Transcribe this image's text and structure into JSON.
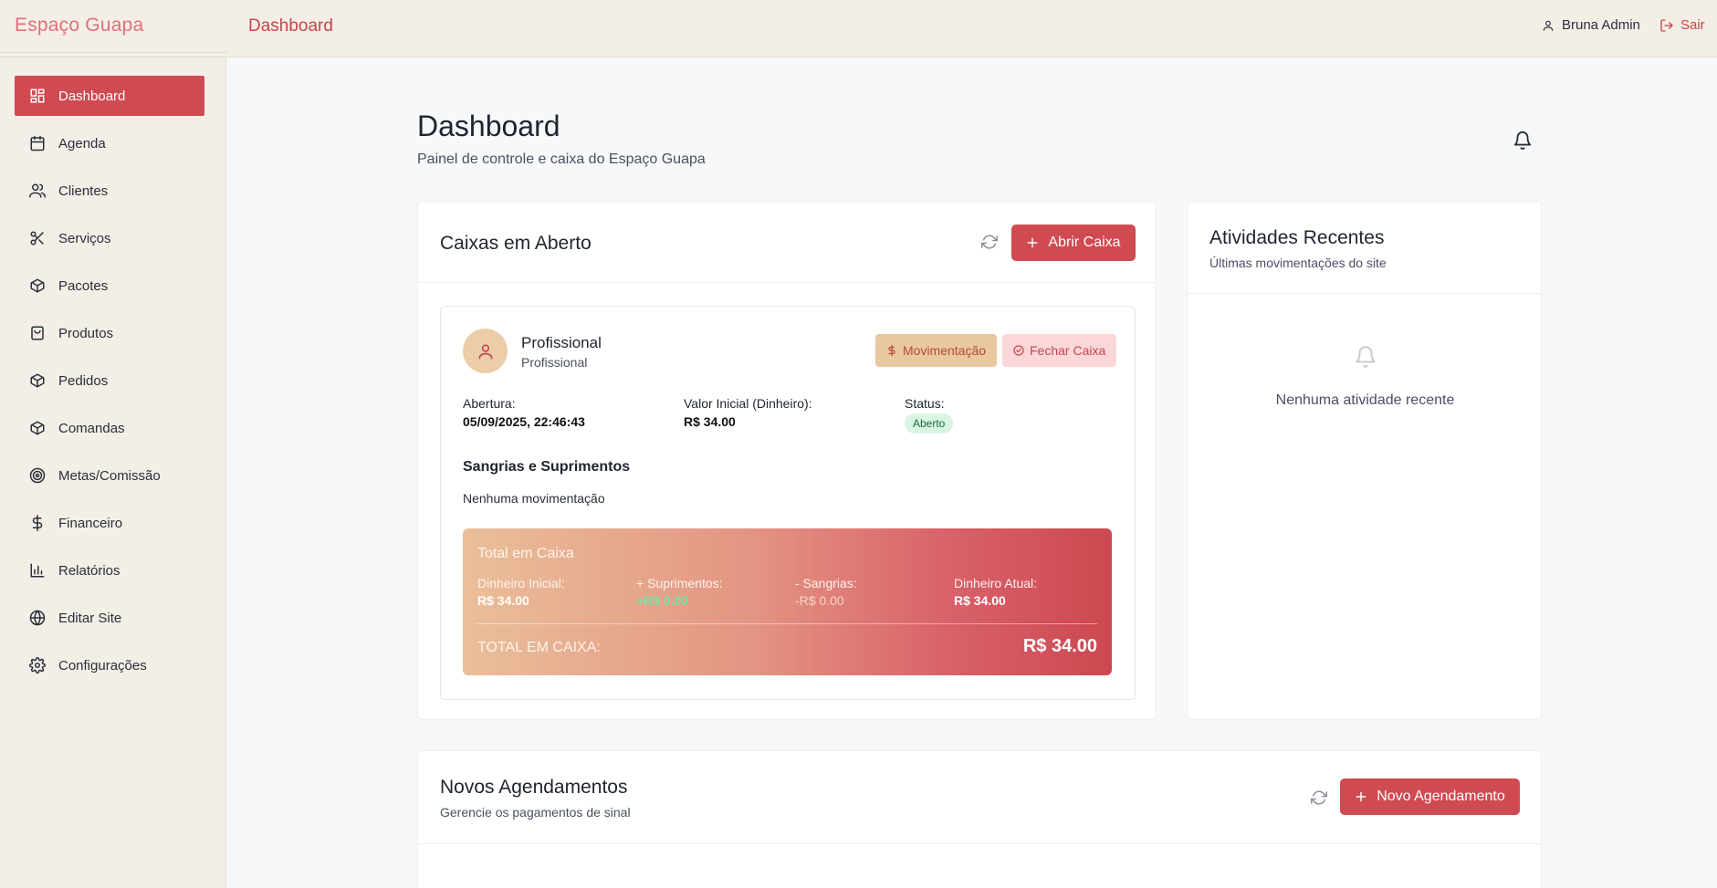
{
  "app": {
    "brand": "Espaço Guapa",
    "header_title": "Dashboard"
  },
  "user": {
    "name": "Bruna Admin",
    "logout_label": "Sair"
  },
  "sidebar": {
    "items": [
      {
        "label": "Dashboard",
        "icon": "dashboard-icon",
        "active": true
      },
      {
        "label": "Agenda",
        "icon": "calendar-icon"
      },
      {
        "label": "Clientes",
        "icon": "users-icon"
      },
      {
        "label": "Serviços",
        "icon": "scissors-icon"
      },
      {
        "label": "Pacotes",
        "icon": "package-icon"
      },
      {
        "label": "Produtos",
        "icon": "shopping-bag-icon"
      },
      {
        "label": "Pedidos",
        "icon": "package-icon"
      },
      {
        "label": "Comandas",
        "icon": "package-icon"
      },
      {
        "label": "Metas/Comissão",
        "icon": "target-icon"
      },
      {
        "label": "Financeiro",
        "icon": "dollar-icon"
      },
      {
        "label": "Relatórios",
        "icon": "bar-chart-icon"
      },
      {
        "label": "Editar Site",
        "icon": "globe-icon"
      },
      {
        "label": "Configurações",
        "icon": "gear-icon"
      }
    ]
  },
  "page": {
    "title": "Dashboard",
    "subtitle": "Painel de controle e caixa do Espaço Guapa"
  },
  "caixas": {
    "title": "Caixas em Aberto",
    "open_button": "Abrir Caixa",
    "session": {
      "name": "Profissional",
      "role": "Profissional",
      "movement_button": "Movimentação",
      "close_button": "Fechar Caixa",
      "opening_label": "Abertura:",
      "opening_value": "05/09/2025, 22:46:43",
      "initial_label": "Valor Inicial (Dinheiro):",
      "initial_value": "R$ 34.00",
      "status_label": "Status:",
      "status_value": "Aberto",
      "movements_title": "Sangrias e Suprimentos",
      "movements_empty": "Nenhuma movimentação",
      "total": {
        "heading": "Total em Caixa",
        "cash_initial_label": "Dinheiro Inicial:",
        "cash_initial_value": "R$ 34.00",
        "supplies_label": "+ Suprimentos:",
        "supplies_value": "+R$ 0.00",
        "withdrawals_label": "- Sangrias:",
        "withdrawals_value": "-R$ 0.00",
        "current_label": "Dinheiro Atual:",
        "current_value": "R$ 34.00",
        "grand_label": "TOTAL EM CAIXA:",
        "grand_value": "R$ 34.00"
      }
    }
  },
  "activities": {
    "title": "Atividades Recentes",
    "subtitle": "Últimas movimentações do site",
    "empty": "Nenhuma atividade recente"
  },
  "appointments": {
    "title": "Novos Agendamentos",
    "subtitle": "Gerencie os pagamentos de sinal",
    "new_button": "Novo Agendamento"
  },
  "colors": {
    "accent": "#cf4a51",
    "sidebar_bg": "#f3eee6",
    "brand": "#e0707a"
  }
}
